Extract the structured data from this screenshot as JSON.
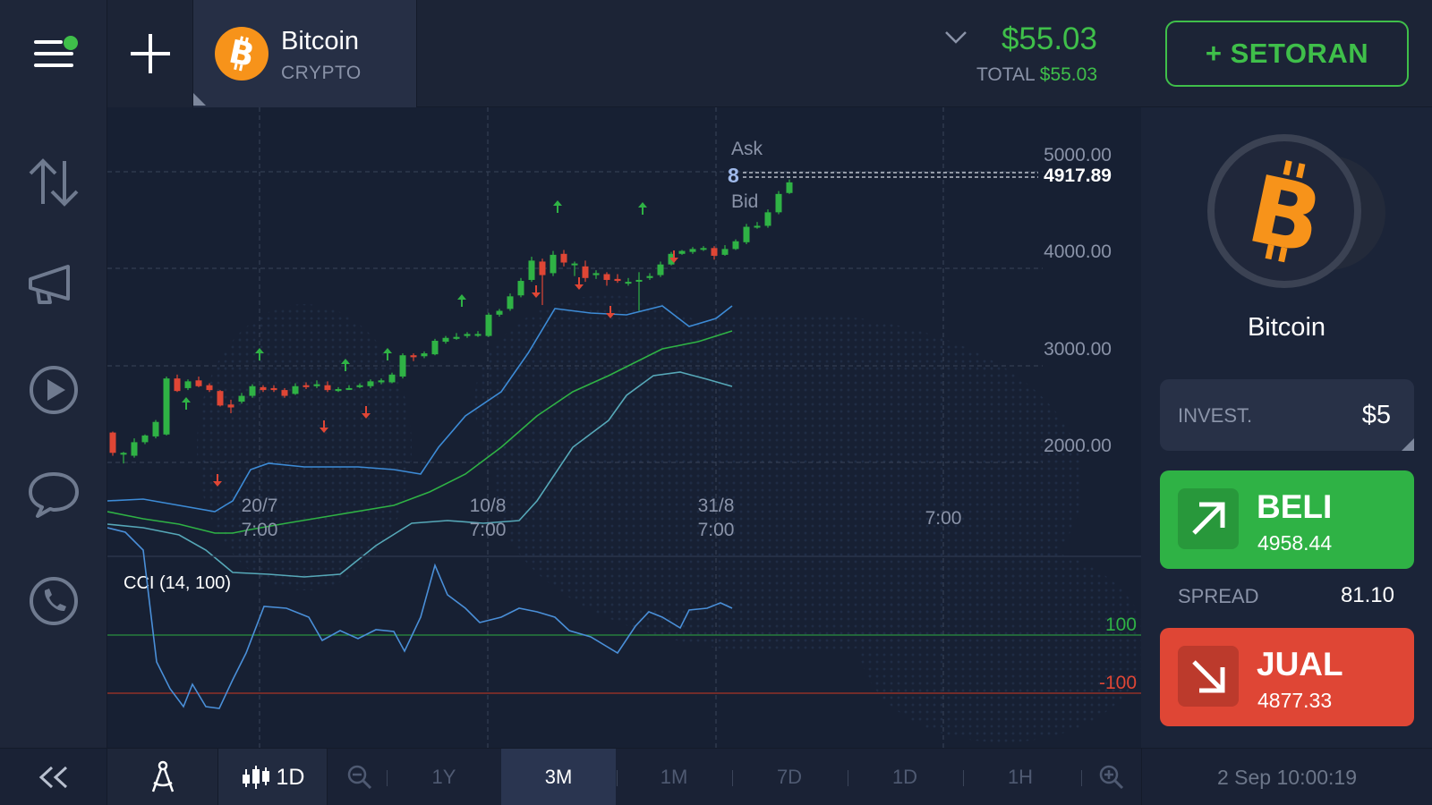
{
  "header": {
    "asset_name": "Bitcoin",
    "asset_type": "CRYPTO",
    "balance": "$55.03",
    "total_label": "TOTAL",
    "total_value": "$55.03",
    "deposit_label": "+ SETORAN"
  },
  "chart": {
    "ask_label": "Ask",
    "bid_label": "Bid",
    "current_price": "4917.89",
    "marker_digit": "8",
    "price_ticks": [
      "5000.00",
      "4000.00",
      "3000.00",
      "2000.00"
    ],
    "time_ticks": [
      {
        "date": "20/7",
        "time": "7:00"
      },
      {
        "date": "10/8",
        "time": "7:00"
      },
      {
        "date": "31/8",
        "time": "7:00"
      },
      {
        "date": "",
        "time": "7:00"
      }
    ],
    "indicator_label": "CCI (14, 100)",
    "indicator_levels": [
      "100",
      "-100"
    ]
  },
  "panel": {
    "asset_name": "Bitcoin",
    "invest_label": "INVEST.",
    "invest_value": "$5",
    "buy_label": "BELI",
    "buy_price": "4958.44",
    "spread_label": "SPREAD",
    "spread_value": "81.10",
    "sell_label": "JUAL",
    "sell_price": "4877.33"
  },
  "toolbar": {
    "chart_type_label": "1D",
    "periods": [
      "1Y",
      "3M",
      "1M",
      "7D",
      "1D",
      "1H"
    ],
    "active_period": "3M",
    "datetime": "2 Sep 10:00:19"
  },
  "colors": {
    "up": "#2fb245",
    "down": "#df4635",
    "bitcoin": "#f7931a",
    "accent_green": "#3fbf4a",
    "band_blue": "#3d8bd6"
  }
}
